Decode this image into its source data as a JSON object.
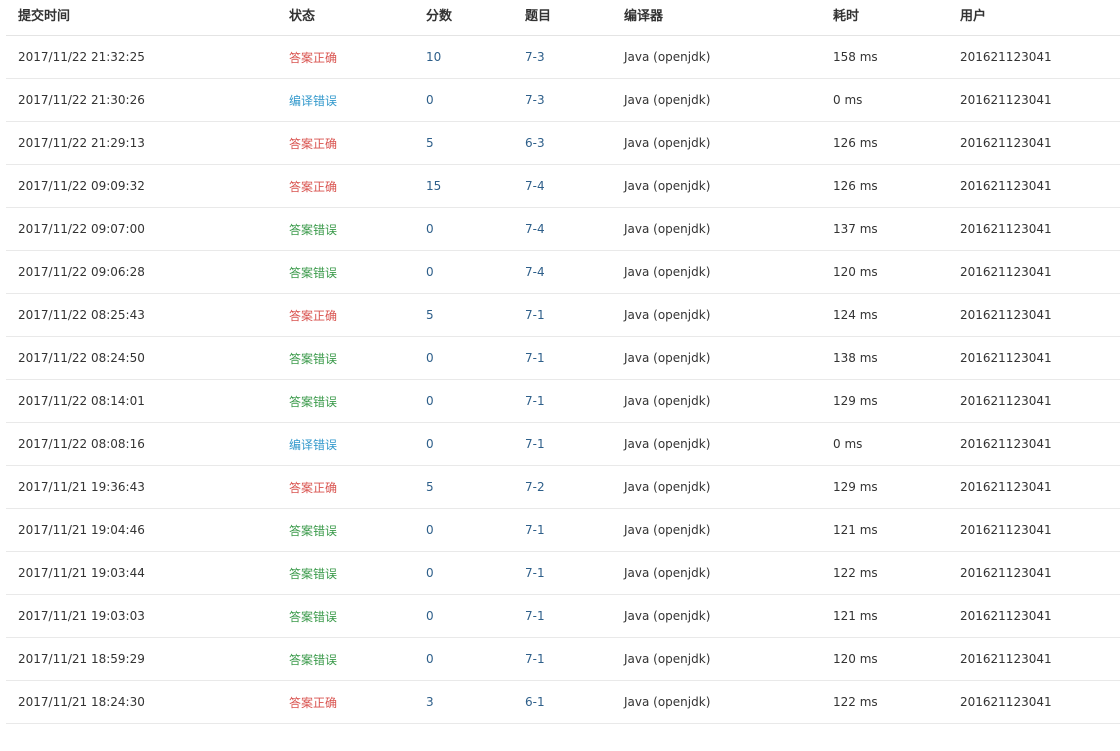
{
  "colors": {
    "accepted": "#d9534f",
    "wrong_answer": "#3a9a4a",
    "compile_error": "#3399cc",
    "link": "#2e5f8a"
  },
  "table": {
    "headers": {
      "time": "提交时间",
      "status": "状态",
      "score": "分数",
      "problem": "题目",
      "compiler": "编译器",
      "cost": "耗时",
      "user": "用户"
    },
    "rows": [
      {
        "time": "2017/11/22 21:32:25",
        "status": "答案正确",
        "status_type": "accepted",
        "score": "10",
        "problem": "7-3",
        "compiler": "Java (openjdk)",
        "cost": "158 ms",
        "user": "201621123041"
      },
      {
        "time": "2017/11/22 21:30:26",
        "status": "编译错误",
        "status_type": "compile",
        "score": "0",
        "problem": "7-3",
        "compiler": "Java (openjdk)",
        "cost": "0 ms",
        "user": "201621123041"
      },
      {
        "time": "2017/11/22 21:29:13",
        "status": "答案正确",
        "status_type": "accepted",
        "score": "5",
        "problem": "6-3",
        "compiler": "Java (openjdk)",
        "cost": "126 ms",
        "user": "201621123041"
      },
      {
        "time": "2017/11/22 09:09:32",
        "status": "答案正确",
        "status_type": "accepted",
        "score": "15",
        "problem": "7-4",
        "compiler": "Java (openjdk)",
        "cost": "126 ms",
        "user": "201621123041"
      },
      {
        "time": "2017/11/22 09:07:00",
        "status": "答案错误",
        "status_type": "wrong",
        "score": "0",
        "problem": "7-4",
        "compiler": "Java (openjdk)",
        "cost": "137 ms",
        "user": "201621123041"
      },
      {
        "time": "2017/11/22 09:06:28",
        "status": "答案错误",
        "status_type": "wrong",
        "score": "0",
        "problem": "7-4",
        "compiler": "Java (openjdk)",
        "cost": "120 ms",
        "user": "201621123041"
      },
      {
        "time": "2017/11/22 08:25:43",
        "status": "答案正确",
        "status_type": "accepted",
        "score": "5",
        "problem": "7-1",
        "compiler": "Java (openjdk)",
        "cost": "124 ms",
        "user": "201621123041"
      },
      {
        "time": "2017/11/22 08:24:50",
        "status": "答案错误",
        "status_type": "wrong",
        "score": "0",
        "problem": "7-1",
        "compiler": "Java (openjdk)",
        "cost": "138 ms",
        "user": "201621123041"
      },
      {
        "time": "2017/11/22 08:14:01",
        "status": "答案错误",
        "status_type": "wrong",
        "score": "0",
        "problem": "7-1",
        "compiler": "Java (openjdk)",
        "cost": "129 ms",
        "user": "201621123041"
      },
      {
        "time": "2017/11/22 08:08:16",
        "status": "编译错误",
        "status_type": "compile",
        "score": "0",
        "problem": "7-1",
        "compiler": "Java (openjdk)",
        "cost": "0 ms",
        "user": "201621123041"
      },
      {
        "time": "2017/11/21 19:36:43",
        "status": "答案正确",
        "status_type": "accepted",
        "score": "5",
        "problem": "7-2",
        "compiler": "Java (openjdk)",
        "cost": "129 ms",
        "user": "201621123041"
      },
      {
        "time": "2017/11/21 19:04:46",
        "status": "答案错误",
        "status_type": "wrong",
        "score": "0",
        "problem": "7-1",
        "compiler": "Java (openjdk)",
        "cost": "121 ms",
        "user": "201621123041"
      },
      {
        "time": "2017/11/21 19:03:44",
        "status": "答案错误",
        "status_type": "wrong",
        "score": "0",
        "problem": "7-1",
        "compiler": "Java (openjdk)",
        "cost": "122 ms",
        "user": "201621123041"
      },
      {
        "time": "2017/11/21 19:03:03",
        "status": "答案错误",
        "status_type": "wrong",
        "score": "0",
        "problem": "7-1",
        "compiler": "Java (openjdk)",
        "cost": "121 ms",
        "user": "201621123041"
      },
      {
        "time": "2017/11/21 18:59:29",
        "status": "答案错误",
        "status_type": "wrong",
        "score": "0",
        "problem": "7-1",
        "compiler": "Java (openjdk)",
        "cost": "120 ms",
        "user": "201621123041"
      },
      {
        "time": "2017/11/21 18:24:30",
        "status": "答案正确",
        "status_type": "accepted",
        "score": "3",
        "problem": "6-1",
        "compiler": "Java (openjdk)",
        "cost": "122 ms",
        "user": "201621123041"
      }
    ]
  }
}
